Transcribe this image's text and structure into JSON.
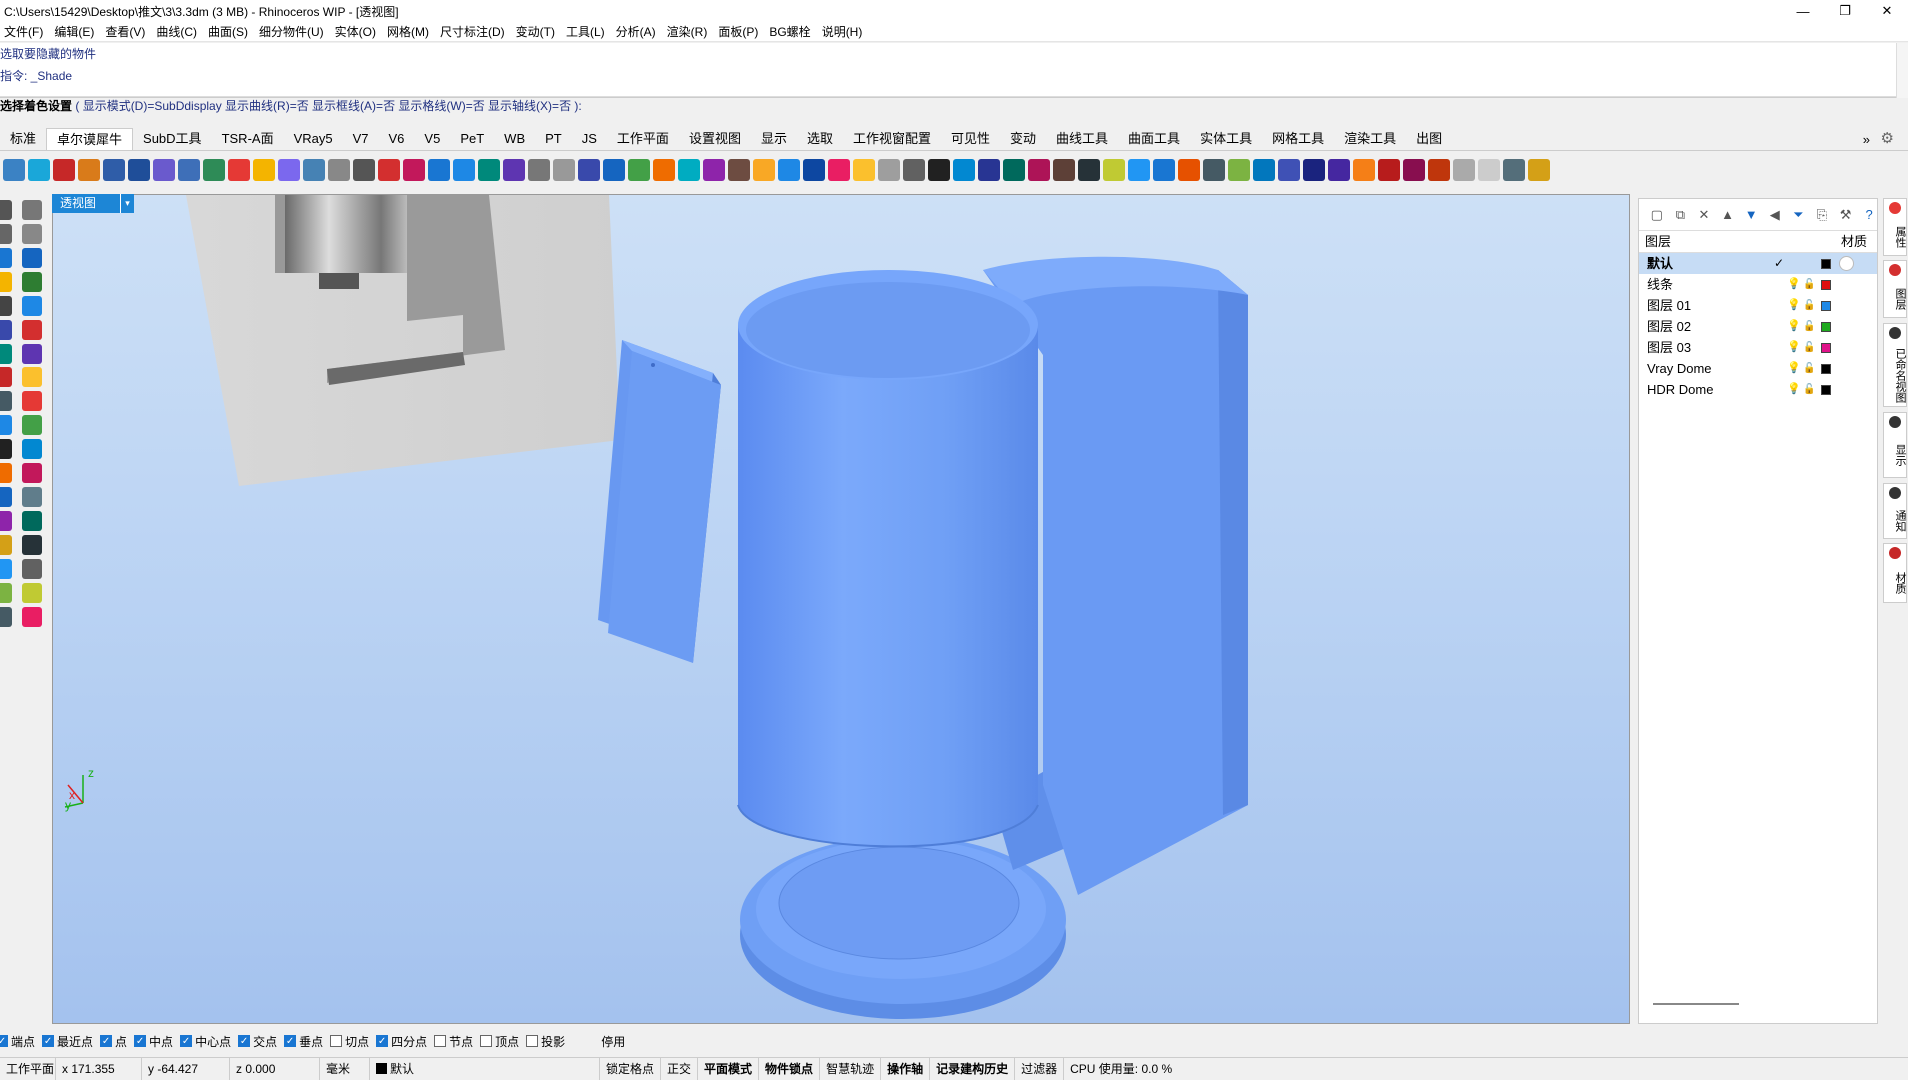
{
  "window": {
    "title": "C:\\Users\\15429\\Desktop\\推文\\3\\3.3dm (3 MB) - Rhinoceros WIP - [透视图]",
    "minimize": "—",
    "maximize": "❐",
    "close": "✕"
  },
  "menu": [
    "文件(F)",
    "编辑(E)",
    "查看(V)",
    "曲线(C)",
    "曲面(S)",
    "细分物件(U)",
    "实体(O)",
    "网格(M)",
    "尺寸标注(D)",
    "变动(T)",
    "工具(L)",
    "分析(A)",
    "渲染(R)",
    "面板(P)",
    "BG螺栓",
    "说明(H)"
  ],
  "command": {
    "history": [
      "选取要隐藏的物件",
      "指令: _Shade"
    ],
    "prompt_label": "选择着色设置",
    "prompt_options": "( 显示模式(D)=SubDdisplay  显示曲线(R)=否  显示框线(A)=否  显示格线(W)=否  显示轴线(X)=否 ):"
  },
  "tabs": [
    "标准",
    "卓尔谟犀牛",
    "SubD工具",
    "TSR-A面",
    "VRay5",
    "V7",
    "V6",
    "V5",
    "PeT",
    "WB",
    "PT",
    "JS",
    "工作平面",
    "设置视图",
    "显示",
    "选取",
    "工作视窗配置",
    "可见性",
    "变动",
    "曲线工具",
    "曲面工具",
    "实体工具",
    "网格工具",
    "渲染工具",
    "出图"
  ],
  "active_tab": "卓尔谟犀牛",
  "tabs_more": "»",
  "viewport": {
    "label": "透视图",
    "dropdown": "▾",
    "axes": {
      "x": "x",
      "y": "y",
      "z": "z"
    }
  },
  "layers_panel": {
    "header": "图层",
    "material_header": "材质",
    "layers": [
      {
        "name": "默认",
        "current": true,
        "color": "#000000"
      },
      {
        "name": "线条",
        "current": false,
        "color": "#e01010"
      },
      {
        "name": "图层 01",
        "current": false,
        "color": "#1e88e5"
      },
      {
        "name": "图层 02",
        "current": false,
        "color": "#1faa1f"
      },
      {
        "name": "图层 03",
        "current": false,
        "color": "#e0138a"
      },
      {
        "name": "Vray Dome",
        "current": false,
        "color": "#000000"
      },
      {
        "name": "HDR Dome",
        "current": false,
        "color": "#000000"
      }
    ]
  },
  "side_tabs": [
    "属性",
    "图层",
    "已命名视图",
    "显示",
    "通知",
    "材质"
  ],
  "osnap": [
    {
      "label": "端点",
      "on": true
    },
    {
      "label": "最近点",
      "on": true
    },
    {
      "label": "点",
      "on": true
    },
    {
      "label": "中点",
      "on": true
    },
    {
      "label": "中心点",
      "on": true
    },
    {
      "label": "交点",
      "on": true
    },
    {
      "label": "垂点",
      "on": true
    },
    {
      "label": "切点",
      "on": false
    },
    {
      "label": "四分点",
      "on": true
    },
    {
      "label": "节点",
      "on": false
    },
    {
      "label": "顶点",
      "on": false
    },
    {
      "label": "投影",
      "on": false
    },
    {
      "label": "停用",
      "on": false
    }
  ],
  "status": {
    "cplane": "工作平面",
    "x": "x 171.355",
    "y": "y -64.427",
    "z": "z 0.000",
    "unit": "毫米",
    "layer": "默认",
    "toggles": [
      "锁定格点",
      "正交",
      "平面模式",
      "物件锁点",
      "智慧轨迹",
      "操作轴",
      "记录建构历史",
      "过滤器"
    ],
    "cpu": "CPU 使用量: 0.0 %"
  },
  "colors": {
    "model_blue": "#6f9ff5",
    "viewport_top": "#cde0f6",
    "viewport_bottom": "#a4c2ee",
    "accent": "#1d86d6"
  }
}
